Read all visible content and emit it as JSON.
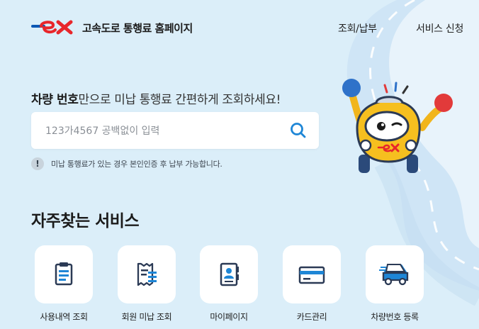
{
  "header": {
    "site_title": "고속도로 통행료 홈페이지",
    "nav": [
      "조회/납부",
      "서비스 신청"
    ]
  },
  "hero": {
    "headline_bold": "차량 번호",
    "headline_rest": "만으로 미납 통행료 간편하게 조회하세요!"
  },
  "search": {
    "placeholder": "123가4567 공백없이 입력",
    "value": ""
  },
  "notice": {
    "icon": "!",
    "text": "미납 통행료가 있는 경우 본인인증 후 납부 가능합니다."
  },
  "services": {
    "title": "자주찾는 서비스",
    "items": [
      {
        "label": "사용내역 조회",
        "icon": "clipboard-list-icon"
      },
      {
        "label": "회원 미납 조회",
        "icon": "receipt-icon"
      },
      {
        "label": "마이페이지",
        "icon": "profile-book-icon"
      },
      {
        "label": "카드관리",
        "icon": "credit-card-icon"
      },
      {
        "label": "차량번호 등록",
        "icon": "car-icon"
      }
    ]
  },
  "colors": {
    "brand_red": "#e8262b",
    "brand_blue": "#0a57b4",
    "accent_blue": "#1e86d6",
    "background": "#dbeef9"
  }
}
